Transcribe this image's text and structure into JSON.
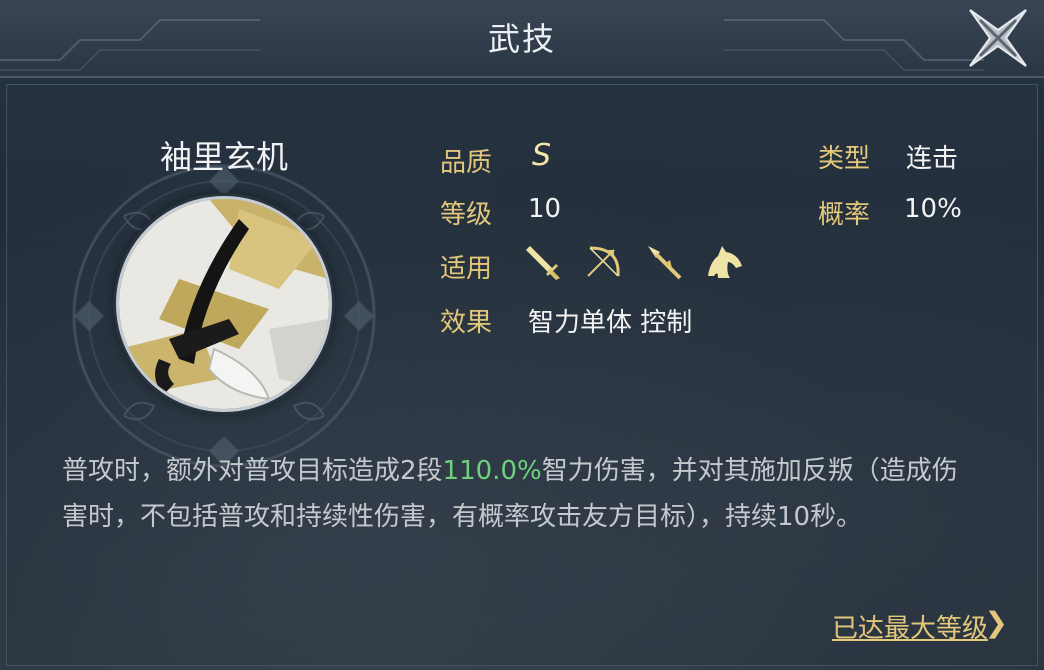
{
  "header": {
    "title": "武技"
  },
  "skill": {
    "name": "袖里玄机",
    "attributes": {
      "quality": {
        "label": "品质",
        "value": "S"
      },
      "level": {
        "label": "等级",
        "value": "10"
      },
      "applicable": {
        "label": "适用",
        "weapons": [
          "sword-icon",
          "bow-icon",
          "spear-icon",
          "horse-icon"
        ]
      },
      "effect": {
        "label": "效果",
        "value": "智力单体 控制"
      },
      "type": {
        "label": "类型",
        "value": "连击"
      },
      "chance": {
        "label": "概率",
        "value": "10%"
      }
    },
    "description": {
      "before": "普攻时，额外对普攻目标造成2段",
      "highlight": "110.0%",
      "after": "智力伤害，并对其施加反叛（造成伤害时，不包括普攻和持续性伤害，有概率攻击友方目标），持续10秒。"
    },
    "max_level_link": "已达最大等级",
    "max_level_chevron": "❯"
  },
  "colors": {
    "label_gold": "#e3c77a",
    "highlight_green": "#6fd17d",
    "quality_gold": "#f5e7a8"
  }
}
